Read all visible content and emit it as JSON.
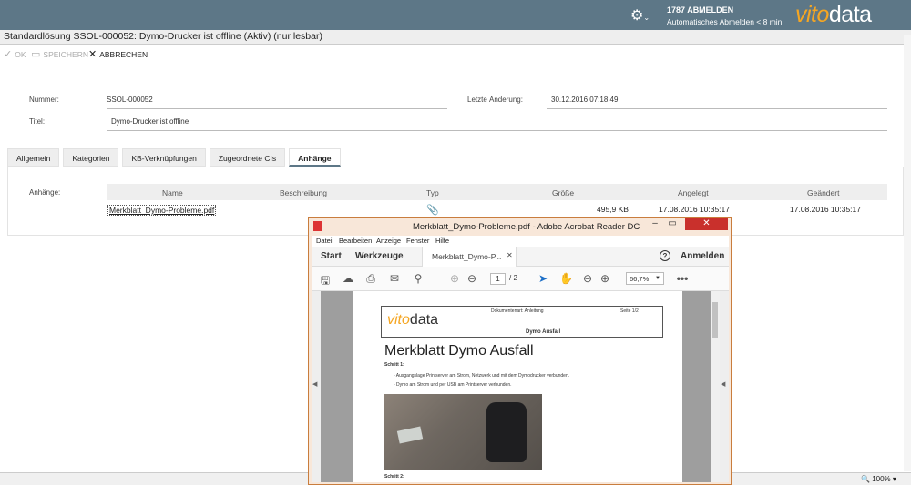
{
  "header": {
    "user": "1787 ABMELDEN",
    "logout_note": "Automatisches Abmelden < 8 min",
    "logo_vito": "vito",
    "logo_data": "data"
  },
  "title": "Standardlösung SSOL-000052: Dymo-Drucker ist offline (Aktiv) (nur lesbar)",
  "actions": {
    "ok": "OK",
    "save": "SPEICHERN",
    "cancel": "ABBRECHEN"
  },
  "form": {
    "number_label": "Nummer:",
    "number_value": "SSOL-000052",
    "changed_label": "Letzte Änderung:",
    "changed_value": "30.12.2016 07:18:49",
    "title_label": "Titel:",
    "title_value": "Dymo-Drucker ist offline"
  },
  "tabs": [
    "Allgemein",
    "Kategorien",
    "KB-Verknüpfungen",
    "Zugeordnete CIs",
    "Anhänge"
  ],
  "attachments": {
    "label": "Anhänge:",
    "columns": [
      "Name",
      "Beschreibung",
      "Typ",
      "Größe",
      "Angelegt",
      "Geändert"
    ],
    "rows": [
      {
        "name": "Merkblatt_Dymo-Probleme.pdf",
        "size": "495,9 KB",
        "created": "17.08.2016 10:35:17",
        "changed": "17.08.2016 10:35:17"
      }
    ]
  },
  "status": {
    "zoom": "100%"
  },
  "acrobat": {
    "window_title": "Merkblatt_Dymo-Probleme.pdf - Adobe Acrobat Reader DC",
    "menu": [
      "Datei",
      "Bearbeiten",
      "Anzeige",
      "Fenster",
      "Hilfe"
    ],
    "nav_start": "Start",
    "nav_tools": "Werkzeuge",
    "doc_tab": "Merkblatt_Dymo-P...",
    "signin": "Anmelden",
    "page_current": "1",
    "page_total": "/ 2",
    "zoom": "66,7%",
    "pdf": {
      "logo_vito": "vito",
      "logo_data": "data",
      "doctype": "Dokumentenart: Anleitung",
      "pageno": "Seite 1/2",
      "subject": "Dymo Ausfall",
      "title": "Merkblatt Dymo Ausfall",
      "step1": "Schritt 1:",
      "bullet1": "-   Ausgangslage Printserver am Strom, Netzwerk und mit dem Dymodrucker verbunden.",
      "bullet2": "-   Dymo am Strom und per USB am Printserver verbunden.",
      "step2": "Schritt 2:"
    }
  }
}
